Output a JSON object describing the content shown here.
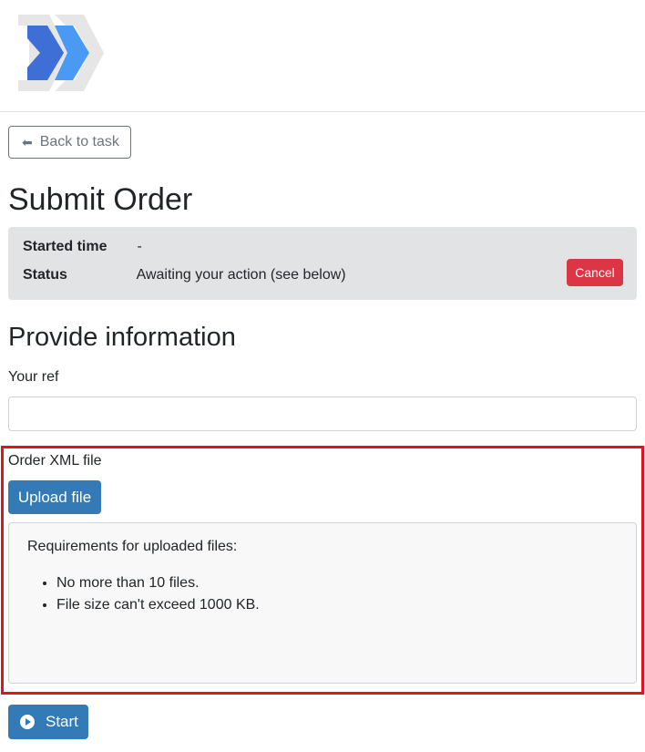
{
  "logo": {
    "icon": "double-chevron-logo",
    "colors": [
      "#3d6fd6",
      "#4a9af5",
      "#e6e6e6"
    ]
  },
  "nav": {
    "back_label": "Back to task",
    "back_icon": "left-arrow-icon"
  },
  "page": {
    "title": "Submit Order"
  },
  "info": {
    "started_label": "Started time",
    "started_value": "-",
    "status_label": "Status",
    "status_value": "Awaiting your action (see below)",
    "cancel_label": "Cancel"
  },
  "form": {
    "section_title": "Provide information",
    "ref_label": "Your ref",
    "ref_value": "",
    "file_label": "Order XML file",
    "upload_label": "Upload file",
    "requirements_title": "Requirements for uploaded files:",
    "requirements": [
      "No more than 10 files.",
      "File size can't exceed 1000 KB."
    ],
    "start_label": "Start"
  },
  "colors": {
    "primary": "#337ab7",
    "danger": "#dc3545",
    "highlight": "#e0141e",
    "panel": "#e2e3e5"
  }
}
